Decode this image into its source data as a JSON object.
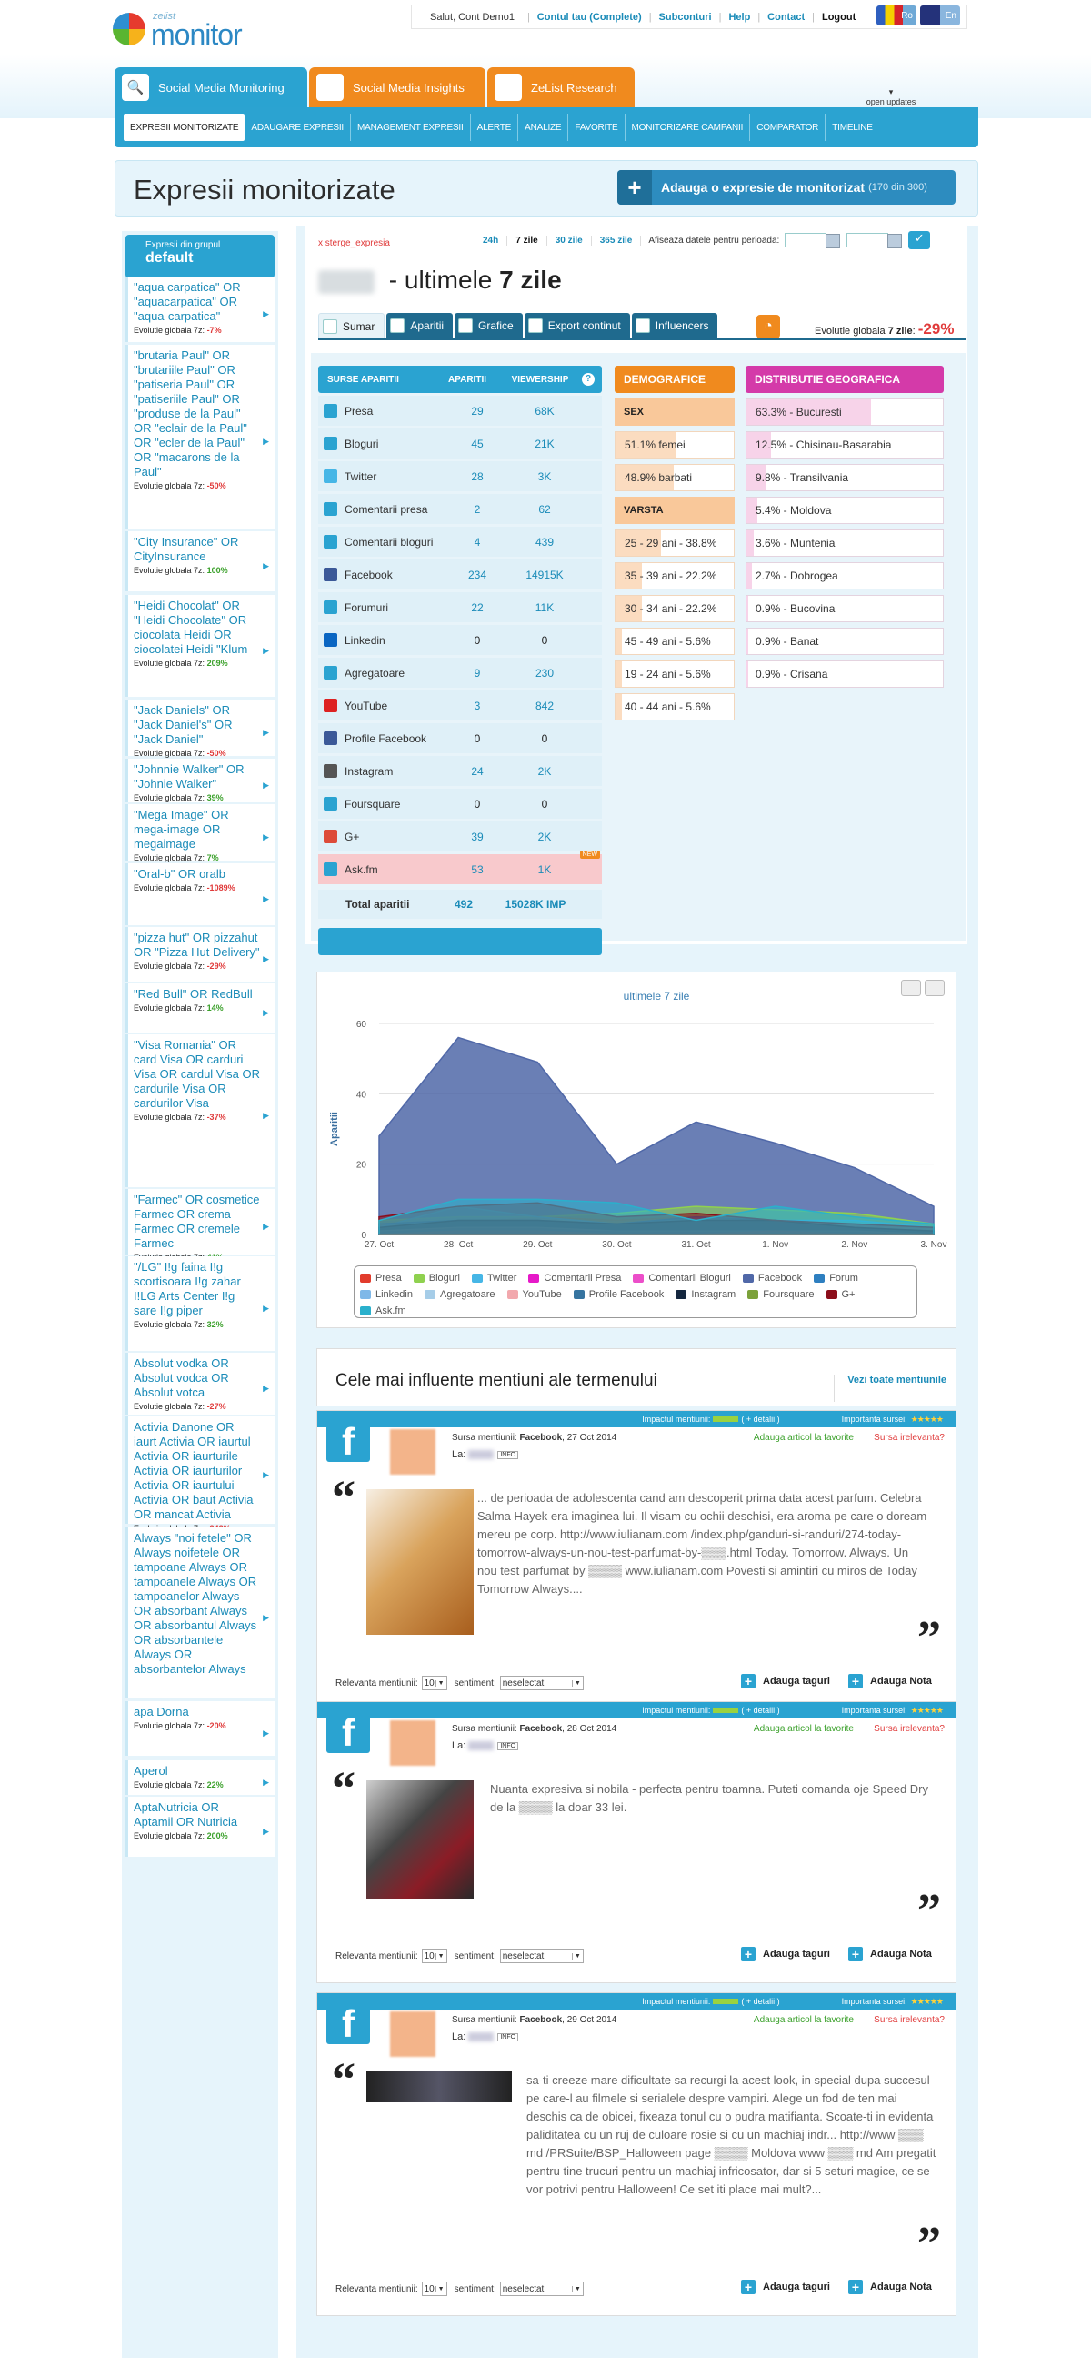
{
  "header": {
    "logo_small": "zelist",
    "logo_big": "monitor",
    "greeting": "Salut, Cont Demo1",
    "links": [
      "Contul tau (Complete)",
      "Subconturi",
      "Help",
      "Contact"
    ],
    "logout": "Logout",
    "lang_ro": "Ro",
    "lang_en": "En",
    "open_updates": "open updates"
  },
  "product_tabs": [
    "Social Media Monitoring",
    "Social Media Insights",
    "ZeList Research"
  ],
  "subnav": [
    "EXPRESII MONITORIZATE",
    "ADAUGARE EXPRESII",
    "MANAGEMENT EXPRESII",
    "ALERTE",
    "ANALIZE",
    "FAVORITE",
    "MONITORIZARE CAMPANII",
    "COMPARATOR",
    "TIMELINE"
  ],
  "page": {
    "title": "Expresii monitorizate",
    "add_button": "Adauga o expresie de monitorizat",
    "add_count": "(170 din 300)"
  },
  "sidebar": {
    "group_label": "Expresii din grupul",
    "group_name": "default",
    "ev_label": "Evolutie globala 7z:",
    "items": [
      {
        "q": "\"aqua carpatica\" OR \"aquacarpatica\" OR \"aqua-carpatica\"",
        "ev": "-7%",
        "neg": true
      },
      {
        "q": "\"brutaria Paul\" OR \"brutariile Paul\" OR \"patiseria Paul\" OR \"patiseriile Paul\" OR \"produse de la Paul\" OR \"eclair de la Paul\" OR \"ecler de la Paul\" OR \"macarons de la Paul\"",
        "ev": "-50%",
        "neg": true
      },
      {
        "q": "\"City Insurance\" OR CityInsurance",
        "ev": "100%",
        "neg": false
      },
      {
        "q": "\"Heidi Chocolat\" OR \"Heidi Chocolate\" OR ciocolata Heidi OR ciocolatei Heidi \"Klum",
        "ev": "209%",
        "neg": false
      },
      {
        "q": "\"Jack Daniels\" OR \"Jack Daniel's\" OR \"Jack Daniel\"",
        "ev": "-50%",
        "neg": true
      },
      {
        "q": "\"Johnnie Walker\" OR \"Johnie Walker\"",
        "ev": "39%",
        "neg": false
      },
      {
        "q": "\"Mega Image\" OR mega-image OR megaimage",
        "ev": "7%",
        "neg": false
      },
      {
        "q": "\"Oral-b\" OR oralb",
        "ev": "-1089%",
        "neg": true
      },
      {
        "q": "\"pizza hut\" OR pizzahut OR \"Pizza Hut Delivery\"",
        "ev": "-29%",
        "neg": true
      },
      {
        "q": "\"Red Bull\" OR RedBull",
        "ev": "14%",
        "neg": false
      },
      {
        "q": "\"Visa Romania\" OR card Visa OR carduri Visa OR cardul Visa OR cardurile Visa OR cardurilor Visa",
        "ev": "-37%",
        "neg": true
      },
      {
        "q": "\"Farmec\" OR cosmetice Farmec OR crema Farmec OR cremele Farmec",
        "ev": "41%",
        "neg": false
      },
      {
        "q": "\"/LG\" I!g faina I!g scortisoara I!g zahar I!LG Arts Center I!g sare I!g piper",
        "ev": "32%",
        "neg": false
      },
      {
        "q": "Absolut vodka OR Absolut vodca OR Absolut votca",
        "ev": "-27%",
        "neg": true
      },
      {
        "q": "Activia Danone OR iaurt Activia OR iaurtul Activia OR iaurturile Activia OR iaurturilor Activia OR iaurtului Activia OR baut Activia OR mancat Activia",
        "ev": "-343%",
        "neg": true
      },
      {
        "q": "Always \"noi fetele\" OR Always noifetele OR tampoane Always OR tampoanele Always OR tampoanelor Always OR absorbant Always OR absorbantul Always OR absorbantele Always OR absorbantelor Always",
        "ev": "",
        "neg": false
      },
      {
        "q": "apa Dorna",
        "ev": "-20%",
        "neg": true
      },
      {
        "q": "Aperol",
        "ev": "22%",
        "neg": false
      },
      {
        "q": "AptaNutricia OR Aptamil OR Nutricia",
        "ev": "200%",
        "neg": false
      }
    ]
  },
  "main": {
    "delete_expr": "x sterge_expresia",
    "periods": [
      "24h",
      "7 zile",
      "30 zile",
      "365 zile"
    ],
    "period_label": "Afiseaza datele pentru perioada:",
    "title_rest": " - ultimele ",
    "title_bold": "7 zile",
    "tabs": [
      "Sumar",
      "Aparitii",
      "Grafice",
      "Export continut",
      "Influencers"
    ],
    "ev_label": "Evolutie globala ",
    "ev_period": "7 zile",
    "ev_value": "-29%"
  },
  "sources": {
    "headers": [
      "SURSE APARITII",
      "APARITII",
      "VIEWERSHIP"
    ],
    "rows": [
      {
        "name": "Presa",
        "a": "29",
        "v": "68K"
      },
      {
        "name": "Bloguri",
        "a": "45",
        "v": "21K"
      },
      {
        "name": "Twitter",
        "a": "28",
        "v": "3K"
      },
      {
        "name": "Comentarii presa",
        "a": "2",
        "v": "62"
      },
      {
        "name": "Comentarii bloguri",
        "a": "4",
        "v": "439"
      },
      {
        "name": "Facebook",
        "a": "234",
        "v": "14915K"
      },
      {
        "name": "Forumuri",
        "a": "22",
        "v": "11K"
      },
      {
        "name": "Linkedin",
        "a": "0",
        "v": "0"
      },
      {
        "name": "Agregatoare",
        "a": "9",
        "v": "230"
      },
      {
        "name": "YouTube",
        "a": "3",
        "v": "842"
      },
      {
        "name": "Profile Facebook",
        "a": "0",
        "v": "0"
      },
      {
        "name": "Instagram",
        "a": "24",
        "v": "2K"
      },
      {
        "name": "Foursquare",
        "a": "0",
        "v": "0"
      },
      {
        "name": "G+",
        "a": "39",
        "v": "2K"
      },
      {
        "name": "Ask.fm",
        "a": "53",
        "v": "1K"
      }
    ],
    "new_badge": "NEW",
    "total_label": "Total aparitii",
    "total_a": "492",
    "total_v": "15028K IMP"
  },
  "demographics": {
    "title": "DEMOGRAFICE",
    "sex_label": "SEX",
    "sex": [
      {
        "t": "51.1% femei",
        "p": 51.1
      },
      {
        "t": "48.9% barbati",
        "p": 48.9
      }
    ],
    "age_label": "VARSTA",
    "age": [
      {
        "t": "25 - 29 ani - 38.8%",
        "p": 38.8
      },
      {
        "t": "35 - 39 ani - 22.2%",
        "p": 22.2
      },
      {
        "t": "30 - 34 ani - 22.2%",
        "p": 22.2
      },
      {
        "t": "45 - 49 ani - 5.6%",
        "p": 5.6
      },
      {
        "t": "19 - 24 ani - 5.6%",
        "p": 5.6
      },
      {
        "t": "40 - 44 ani - 5.6%",
        "p": 5.6
      }
    ]
  },
  "geo": {
    "title": "DISTRIBUTIE GEOGRAFICA",
    "rows": [
      {
        "t": "63.3% - Bucuresti",
        "p": 63.3
      },
      {
        "t": "12.5% - Chisinau-Basarabia",
        "p": 12.5
      },
      {
        "t": "9.8% - Transilvania",
        "p": 9.8
      },
      {
        "t": "5.4% - Moldova",
        "p": 5.4
      },
      {
        "t": "3.6% - Muntenia",
        "p": 3.6
      },
      {
        "t": "2.7% - Dobrogea",
        "p": 2.7
      },
      {
        "t": "0.9% - Bucovina",
        "p": 0.9
      },
      {
        "t": "0.9% - Banat",
        "p": 0.9
      },
      {
        "t": "0.9% - Crisana",
        "p": 0.9
      }
    ]
  },
  "chart_data": {
    "type": "area",
    "subtitle": "ultimele 7 zile",
    "ylabel": "Aparitii",
    "categories": [
      "27. Oct",
      "28. Oct",
      "29. Oct",
      "30. Oct",
      "31. Oct",
      "1. Nov",
      "2. Nov",
      "3. Nov"
    ],
    "ylim": [
      0,
      60
    ],
    "yticks": [
      "0",
      "20",
      "40",
      "60"
    ],
    "series": [
      {
        "name": "Presa",
        "color": "#e23c2c",
        "values": [
          3,
          3,
          5,
          4,
          5,
          3,
          3,
          2
        ]
      },
      {
        "name": "Bloguri",
        "color": "#8fd14f",
        "values": [
          4,
          5,
          5,
          6,
          8,
          7,
          6,
          3
        ]
      },
      {
        "name": "Twitter",
        "color": "#46b6e6",
        "values": [
          2,
          8,
          5,
          3,
          5,
          4,
          4,
          2
        ]
      },
      {
        "name": "Comentarii Presa",
        "color": "#e619c8",
        "values": [
          0,
          0,
          1,
          0,
          1,
          0,
          0,
          0
        ]
      },
      {
        "name": "Comentarii Bloguri",
        "color": "#ec4ec9",
        "values": [
          0,
          1,
          1,
          1,
          1,
          0,
          0,
          0
        ]
      },
      {
        "name": "Facebook",
        "color": "#5068a8",
        "values": [
          28,
          56,
          49,
          20,
          32,
          26,
          19,
          8
        ]
      },
      {
        "name": "Forum",
        "color": "#2e7fc0",
        "values": [
          3,
          4,
          4,
          3,
          5,
          4,
          2,
          1
        ]
      },
      {
        "name": "Linkedin",
        "color": "#7fb8e8",
        "values": [
          0,
          0,
          0,
          0,
          0,
          0,
          0,
          0
        ]
      },
      {
        "name": "Agregatoare",
        "color": "#a6cde8",
        "values": [
          1,
          2,
          2,
          1,
          1,
          1,
          1,
          0
        ]
      },
      {
        "name": "YouTube",
        "color": "#f2a8ad",
        "values": [
          0,
          1,
          1,
          0,
          0,
          1,
          0,
          0
        ]
      },
      {
        "name": "Profile Facebook",
        "color": "#3674a0",
        "values": [
          0,
          0,
          0,
          0,
          0,
          0,
          0,
          0
        ]
      },
      {
        "name": "Instagram",
        "color": "#14273e",
        "values": [
          2,
          4,
          4,
          3,
          4,
          4,
          2,
          1
        ]
      },
      {
        "name": "Foursquare",
        "color": "#7ba13a",
        "values": [
          0,
          0,
          0,
          0,
          0,
          0,
          0,
          0
        ]
      },
      {
        "name": "G+",
        "color": "#8b0d1a",
        "values": [
          5,
          8,
          9,
          5,
          6,
          4,
          3,
          2
        ]
      },
      {
        "name": "Ask.fm",
        "color": "#2ab0cc",
        "values": [
          4,
          10,
          10,
          9,
          4,
          8,
          5,
          3
        ]
      }
    ]
  },
  "influencers": {
    "title": "Cele mai influente mentiuni ale termenului",
    "link": "Vezi toate mentiunile"
  },
  "mention_ui": {
    "impact_label": "Impactul mentiunii:",
    "details": "( + detalii )",
    "importance_label": "Importanta sursei:",
    "stars": "★★★★★",
    "source_label": "Sursa mentiunii:",
    "la": "La:",
    "info": "INFO",
    "fav": "Adauga articol la favorite",
    "irrelevant": "Sursa irelevanta?",
    "relevance_label": "Relevanta mentiunii:",
    "relevance_value": "10",
    "sentiment_label": "sentiment:",
    "sentiment_value": "neselectat",
    "tag_btn": "Adauga taguri",
    "note_btn": "Adauga Nota"
  },
  "mentions": [
    {
      "source": "Facebook",
      "date": ", 27 Oct 2014",
      "text": "... de perioada de adolescenta cand am descoperit prima data acest parfum. Celebra Salma Hayek era imaginea lui. Il visam cu ochii deschisi, era aroma pe care o doream mereu pe corp. http://www.iulianam.com /index.php/ganduri-si-randuri/274-today-tomorrow-always-un-nou-test-parfumat-by-▒▒▒.html Today. Tomorrow. Always. Un nou test parfumat by ▒▒▒▒ www.iulianam.com Povesti si amintiri cu miros de Today Tomorrow Always...."
    },
    {
      "source": "Facebook",
      "date": ", 28 Oct 2014",
      "text": "Nuanta expresiva si nobila - perfecta pentru toamna. Puteti comanda oje Speed Dry de la ▒▒▒▒ la doar 33 lei."
    },
    {
      "source": "Facebook",
      "date": ", 29 Oct 2014",
      "text": "sa-ti creeze mare dificultate sa recurgi la acest look, in special dupa succesul pe care-l au filmele si serialele despre vampiri. Alege un fod de ten mai deschis ca de obicei, fixeaza tonul cu o pudra matifianta. Scoate-ti in evidenta paliditatea cu un ruj de culoare rosie si cu un machiaj indr... http://www ▒▒▒ md /PRSuite/BSP_Halloween page ▒▒▒▒ Moldova www ▒▒▒ md Am pregatit pentru tine trucuri pentru un machiaj infricosator, dar si 5 seturi magice, ce se vor potrivi pentru Halloween! Ce set iti place mai mult?..."
    }
  ]
}
